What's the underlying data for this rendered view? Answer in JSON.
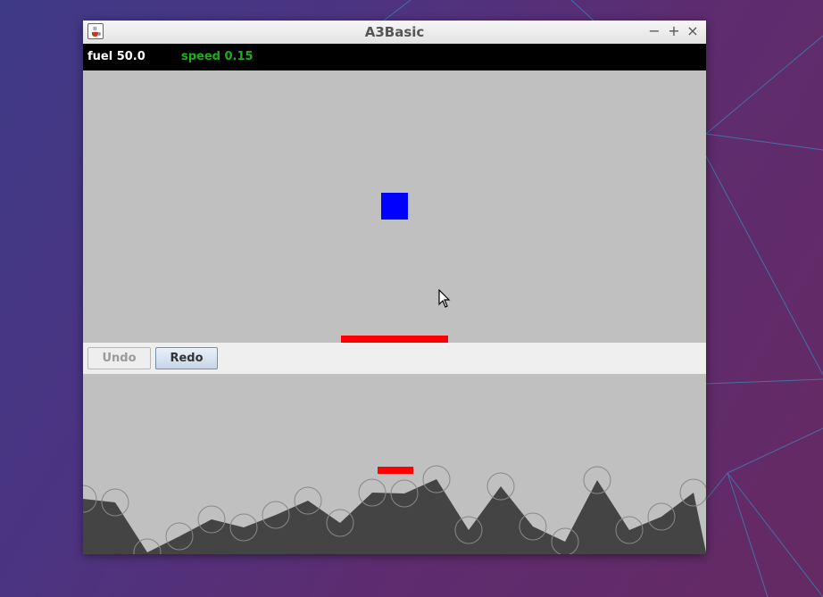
{
  "window": {
    "title": "A3Basic",
    "app_icon": "java-cup-icon",
    "controls": {
      "minimize": "−",
      "maximize": "+",
      "close": "×"
    }
  },
  "status": {
    "fuel_text": "fuel 50.0",
    "speed_text": "speed 0.15",
    "fuel_color": "#ffffff",
    "speed_color": "#16b316"
  },
  "game": {
    "background_color": "#c0c0c0",
    "ship_color": "#0000ff",
    "pad_color": "#ff0000"
  },
  "toolbar": {
    "undo_label": "Undo",
    "redo_label": "Redo",
    "undo_enabled": false,
    "redo_enabled": true
  },
  "map": {
    "terrain_color": "#444444",
    "control_point_color": "#888888"
  }
}
